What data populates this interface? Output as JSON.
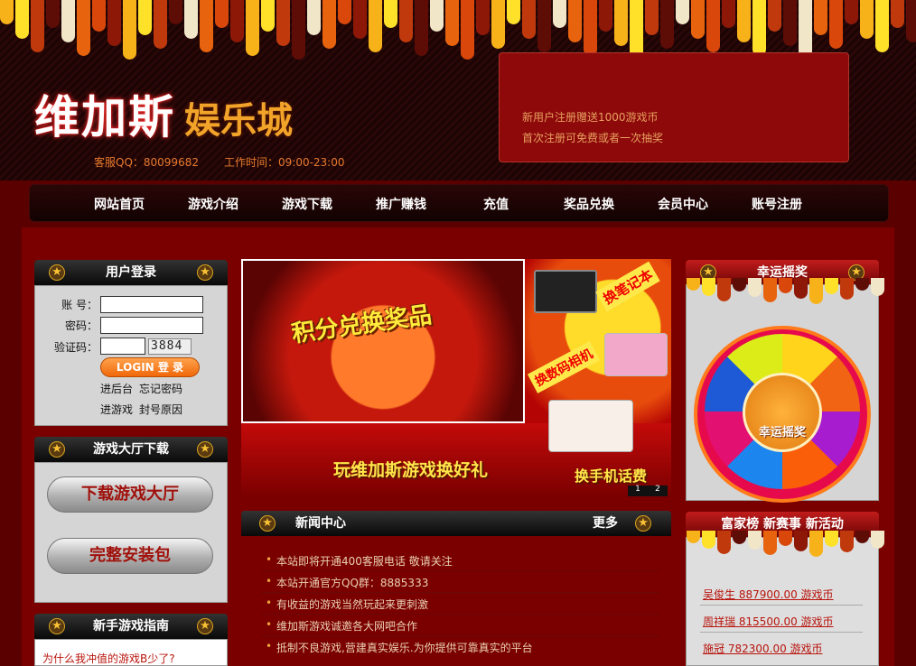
{
  "header": {
    "logo_main": "维加斯",
    "logo_sub": "娱乐城",
    "qq": "客服QQ：80099682",
    "hours": "工作时间：09:00-23:00",
    "promo_1": "新用户注册赠送1000游戏币",
    "promo_2": "首次注册可免费或者一次抽奖"
  },
  "nav": {
    "items": [
      "网站首页",
      "游戏介绍",
      "游戏下载",
      "推广赚钱",
      "充值",
      "奖品兑换",
      "会员中心",
      "账号注册"
    ]
  },
  "login": {
    "title": "用户登录",
    "account_label": "账  号：",
    "password_label": "密码：",
    "captcha_label": "验证码：",
    "captcha_code": "3884",
    "login_button": "LOGIN  登 录",
    "link_backend": "进后台",
    "link_forgot": "忘记密码",
    "link_game": "进游戏",
    "link_ban": "封号原因"
  },
  "download": {
    "title": "游戏大厅下载",
    "btn_hall": "下载游戏大厅",
    "btn_full": "完整安装包"
  },
  "guide": {
    "title": "新手游戏指南",
    "item_1": "为什么我冲值的游戏B少了?"
  },
  "banner": {
    "title": "积分兑换奖品",
    "laptop": "换笔记本",
    "camera": "换数码相机",
    "bottom": "玩维加斯游戏换好礼",
    "phone": "换手机话费",
    "page_1": "1",
    "page_2": "2"
  },
  "news": {
    "title": "新闻中心",
    "more": "更多",
    "items": [
      "本站即将开通400客服电话 敬请关注",
      "本站开通官方QQ群：8885333",
      "有收益的游戏当然玩起来更刺激",
      "维加斯游戏诚邀各大网吧合作",
      "抵制不良游戏,营建真实娱乐.为你提供可靠真实的平台"
    ]
  },
  "lucky": {
    "title": "幸运摇奖",
    "hub_label": "幸运摇奖"
  },
  "rich": {
    "title": "富家榜  新赛事  新活动",
    "items": [
      "吴俊生  887900.00 游戏币",
      "周祥瑞  815500.00 游戏币",
      "施冠  782300.00 游戏币"
    ]
  },
  "colors": {
    "accent_red": "#7a0000",
    "gold": "#f7c234",
    "link_red": "#b8140c"
  }
}
